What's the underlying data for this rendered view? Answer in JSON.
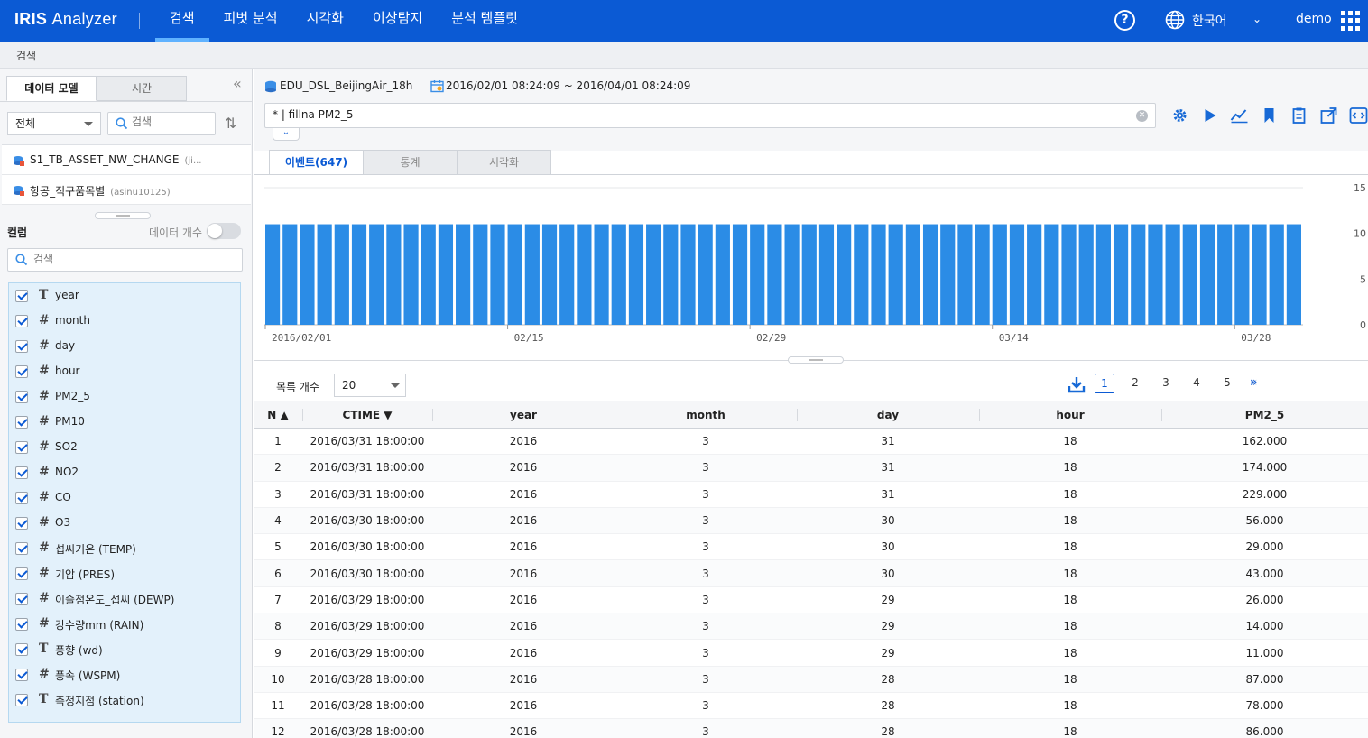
{
  "app": {
    "name_bold": "IRIS",
    "name_rest": "Analyzer"
  },
  "nav": [
    "검색",
    "피벗 분석",
    "시각화",
    "이상탐지",
    "분석 템플릿"
  ],
  "top_right": {
    "help": "?",
    "language": "한국어",
    "user": "demo"
  },
  "breadcrumb": "검색",
  "sidebar": {
    "tabs": [
      "데이터 모델",
      "시간"
    ],
    "filter_value": "전체",
    "search_placeholder": "검색",
    "models": [
      {
        "name": "S1_TB_ASSET_NW_CHANGE",
        "owner": "(ji..."
      },
      {
        "name": "항공_직구품목별",
        "owner": "(asinu10125)"
      }
    ],
    "column_title": "컬럼",
    "count_label": "데이터 개수",
    "column_search_placeholder": "검색",
    "columns": [
      {
        "type": "T",
        "name": "year"
      },
      {
        "type": "#",
        "name": "month"
      },
      {
        "type": "#",
        "name": "day"
      },
      {
        "type": "#",
        "name": "hour"
      },
      {
        "type": "#",
        "name": "PM2_5"
      },
      {
        "type": "#",
        "name": "PM10"
      },
      {
        "type": "#",
        "name": "SO2"
      },
      {
        "type": "#",
        "name": "NO2"
      },
      {
        "type": "#",
        "name": "CO"
      },
      {
        "type": "#",
        "name": "O3"
      },
      {
        "type": "#",
        "name": "섭씨기온 (TEMP)"
      },
      {
        "type": "#",
        "name": "기압 (PRES)"
      },
      {
        "type": "#",
        "name": "이슬점온도_섭씨 (DEWP)"
      },
      {
        "type": "#",
        "name": "강수량mm (RAIN)"
      },
      {
        "type": "T",
        "name": "풍향 (wd)"
      },
      {
        "type": "#",
        "name": "풍속 (WSPM)"
      },
      {
        "type": "T",
        "name": "측정지점 (station)"
      }
    ]
  },
  "main": {
    "dataset": "EDU_DSL_BeijingAir_18h",
    "time_range": "2016/02/01 08:24:09 ~ 2016/04/01 08:24:09",
    "query": "* | fillna PM2_5",
    "tabs": [
      "이벤트(647)",
      "통계",
      "시각화"
    ],
    "list_label": "목록 개수",
    "list_count": "20",
    "pages": [
      "1",
      "2",
      "3",
      "4",
      "5"
    ]
  },
  "chart_data": {
    "type": "bar",
    "x_ticks": [
      "2016/02/01",
      "02/15",
      "02/29",
      "03/14",
      "03/28"
    ],
    "y_ticks": [
      "0",
      "5",
      "10",
      "15"
    ],
    "ylim": [
      0,
      15
    ],
    "bar_count": 60,
    "values": [
      11,
      11,
      11,
      11,
      11,
      11,
      11,
      11,
      11,
      11,
      11,
      11,
      11,
      11,
      11,
      11,
      11,
      11,
      11,
      11,
      11,
      11,
      11,
      11,
      11,
      11,
      11,
      11,
      11,
      11,
      11,
      11,
      11,
      11,
      11,
      11,
      11,
      11,
      11,
      11,
      11,
      11,
      11,
      11,
      11,
      11,
      11,
      11,
      11,
      11,
      11,
      11,
      11,
      11,
      11,
      11,
      11,
      11,
      11,
      11
    ],
    "color": "#2b8ce6"
  },
  "table": {
    "headers": [
      "N ▲",
      "CTIME ▼",
      "year",
      "month",
      "day",
      "hour",
      "PM2_5"
    ],
    "rows": [
      [
        "1",
        "2016/03/31 18:00:00",
        "2016",
        "3",
        "31",
        "18",
        "162.000"
      ],
      [
        "2",
        "2016/03/31 18:00:00",
        "2016",
        "3",
        "31",
        "18",
        "174.000"
      ],
      [
        "3",
        "2016/03/31 18:00:00",
        "2016",
        "3",
        "31",
        "18",
        "229.000"
      ],
      [
        "4",
        "2016/03/30 18:00:00",
        "2016",
        "3",
        "30",
        "18",
        "56.000"
      ],
      [
        "5",
        "2016/03/30 18:00:00",
        "2016",
        "3",
        "30",
        "18",
        "29.000"
      ],
      [
        "6",
        "2016/03/30 18:00:00",
        "2016",
        "3",
        "30",
        "18",
        "43.000"
      ],
      [
        "7",
        "2016/03/29 18:00:00",
        "2016",
        "3",
        "29",
        "18",
        "26.000"
      ],
      [
        "8",
        "2016/03/29 18:00:00",
        "2016",
        "3",
        "29",
        "18",
        "14.000"
      ],
      [
        "9",
        "2016/03/29 18:00:00",
        "2016",
        "3",
        "29",
        "18",
        "11.000"
      ],
      [
        "10",
        "2016/03/28 18:00:00",
        "2016",
        "3",
        "28",
        "18",
        "87.000"
      ],
      [
        "11",
        "2016/03/28 18:00:00",
        "2016",
        "3",
        "28",
        "18",
        "78.000"
      ],
      [
        "12",
        "2016/03/28 18:00:00",
        "2016",
        "3",
        "28",
        "18",
        "86.000"
      ]
    ]
  }
}
